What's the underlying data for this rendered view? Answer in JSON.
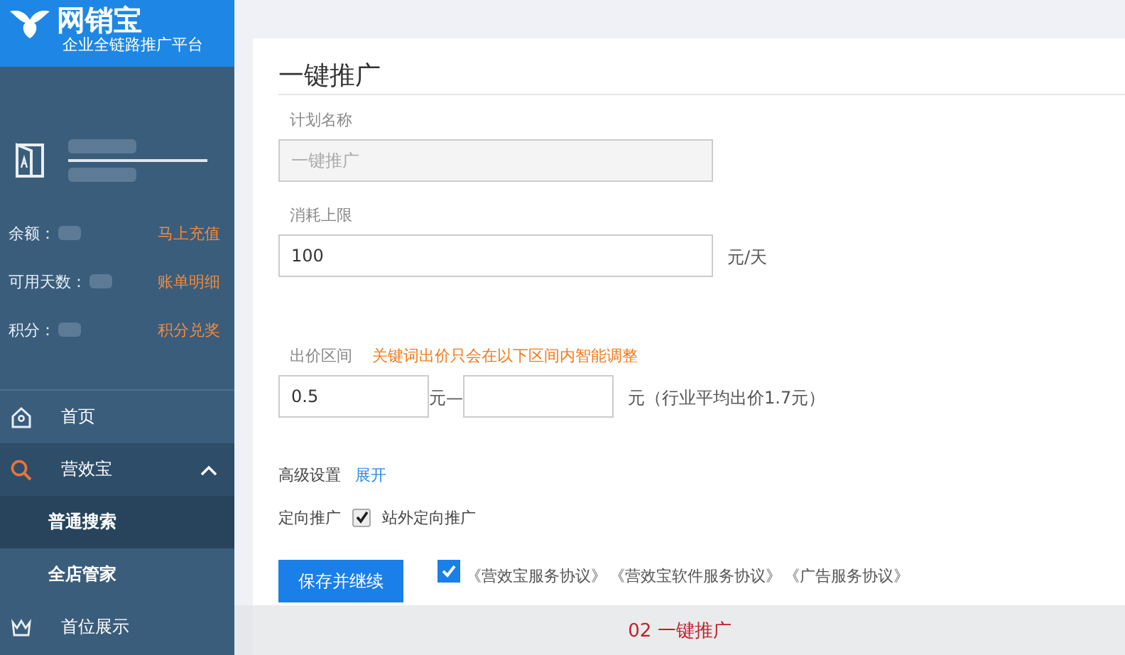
{
  "sidebar": {
    "logo": {
      "name": "网销宝",
      "tagline": "企业全链路推广平台"
    },
    "account": [
      {
        "label": "余额：",
        "link": "马上充值"
      },
      {
        "label": "可用天数：",
        "link": "账单明细"
      },
      {
        "label": "积分：",
        "link": "积分兑奖"
      }
    ],
    "nav": [
      {
        "label": "首页",
        "kind": "home",
        "expanded": false
      },
      {
        "label": "营效宝",
        "kind": "search",
        "expanded": true,
        "children": [
          {
            "label": "普通搜索",
            "selected": true
          },
          {
            "label": "全店管家",
            "selected": false
          }
        ]
      },
      {
        "label": "首位展示",
        "kind": "crown",
        "expanded": false
      }
    ]
  },
  "form": {
    "title": "一键推广",
    "plan_name": {
      "label": "计划名称",
      "value": "一键推广",
      "disabled": true
    },
    "budget": {
      "label": "消耗上限",
      "value": "100",
      "unit": "元/天"
    },
    "bid_range": {
      "label": "出价区间",
      "hint": "关键词出价只会在以下区间内智能调整",
      "min": "0.5",
      "separator": "元—",
      "max_unit": "元（行业平均出价1.7元）"
    },
    "advanced": {
      "label": "高级设置",
      "link": "展开"
    },
    "targeting": {
      "label": "定向推广",
      "option": "站外定向推广",
      "checked": true
    },
    "save_button": "保存并继续",
    "agreement": {
      "checked": true,
      "links": [
        "《营效宝服务协议》",
        "《营效宝软件服务协议》",
        "《广告服务协议》"
      ]
    }
  },
  "caption": "02 一键推广"
}
